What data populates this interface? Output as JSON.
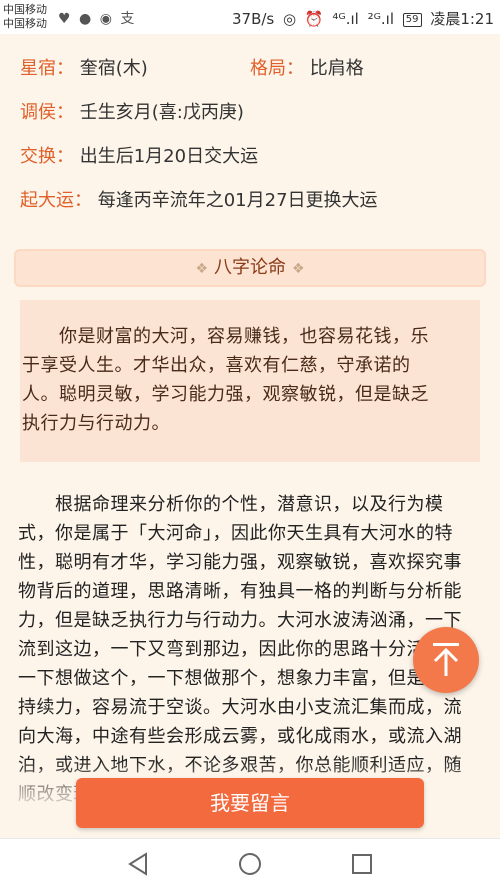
{
  "status_bar": {
    "carrier_1": "中国移动",
    "carrier_2": "中国移动",
    "speed": "37B/s",
    "signal_1": "⁴ᴳ.ıl",
    "signal_2": "²ᴳ.ıl",
    "battery": "59",
    "time": "凌晨1:21"
  },
  "info": [
    {
      "label": "星宿：",
      "value": "奎宿(木)"
    },
    {
      "label": "格局：",
      "value": "比肩格"
    },
    {
      "label": "调侯：",
      "value": "壬生亥月(喜:戊丙庚)"
    },
    {
      "label": "交换：",
      "value": "出生后1月20日交大运"
    },
    {
      "label": "起大运：",
      "value": "每逢丙辛流年之01月27日更换大运"
    }
  ],
  "section": {
    "title": "八字论命",
    "deco": "❖"
  },
  "summary": "　　你是财富的大河，容易赚钱，也容易花钱，乐于享受人生。才华出众，喜欢有仁慈，守承诺的人。聪明灵敏，学习能力强，观察敏锐，但是缺乏执行力与行动力。",
  "main_text": "　　根据命理来分析你的个性，潜意识，以及行为模式，你是属于「大河命」，因此你天生具有大河水的特性，聪明有才华，学习能力强，观察敏锐，喜欢探究事物背后的道理，思路清晰，有独具一格的判断与分析能力，但是缺乏执行力与行动力。大河水波涛汹涌，一下流到这边，一下又弯到那边，因此你的思路十分活跃，一下想做这个，一下想做那个，想象力丰富，但是缺乏持续力，容易流于空谈。大河水由小支流汇集而成，流向大海，中途有些会形成云雾，或化成雨水，或流入湖泊，或进入地下水，不论多艰苦，你总能顺利适应，随顺改变环境。",
  "message_button": "我要留言",
  "colors": {
    "accent": "#e0602a",
    "button": "#f26a3e",
    "background": "#fdf5ea"
  }
}
